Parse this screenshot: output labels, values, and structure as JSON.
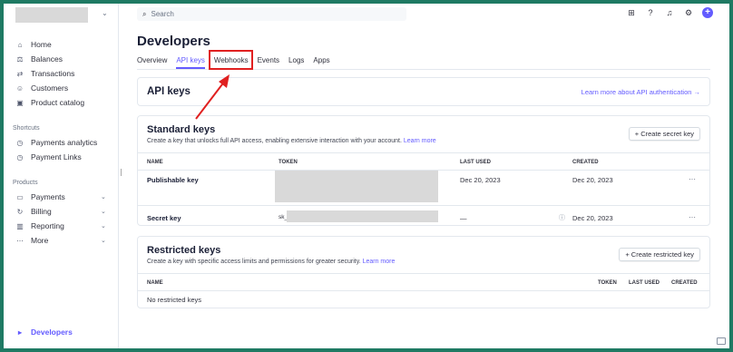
{
  "sidebar": {
    "main_items": [
      {
        "label": "Home",
        "icon": "home-icon",
        "glyph": "⌂"
      },
      {
        "label": "Balances",
        "icon": "balances-icon",
        "glyph": "⚖"
      },
      {
        "label": "Transactions",
        "icon": "transactions-icon",
        "glyph": "⇄"
      },
      {
        "label": "Customers",
        "icon": "customers-icon",
        "glyph": "☺"
      },
      {
        "label": "Product catalog",
        "icon": "product-catalog-icon",
        "glyph": "▣"
      }
    ],
    "shortcuts_title": "Shortcuts",
    "shortcuts": [
      {
        "label": "Payments analytics",
        "icon": "clock-icon",
        "glyph": "◷"
      },
      {
        "label": "Payment Links",
        "icon": "clock-icon",
        "glyph": "◷"
      }
    ],
    "products_title": "Products",
    "products": [
      {
        "label": "Payments",
        "icon": "payments-icon",
        "glyph": "▭"
      },
      {
        "label": "Billing",
        "icon": "billing-icon",
        "glyph": "↻"
      },
      {
        "label": "Reporting",
        "icon": "reporting-icon",
        "glyph": "▥"
      },
      {
        "label": "More",
        "icon": "more-icon",
        "glyph": "⋯"
      }
    ],
    "developers": {
      "label": "Developers",
      "icon": "terminal-icon",
      "glyph": "▸"
    }
  },
  "topbar": {
    "search_placeholder": "Search",
    "icons": [
      "apps-icon",
      "help-icon",
      "bell-icon",
      "settings-icon",
      "plus-icon"
    ]
  },
  "page": {
    "title": "Developers",
    "tabs": [
      "Overview",
      "API keys",
      "Webhooks",
      "Events",
      "Logs",
      "Apps"
    ],
    "active_tab": "API keys"
  },
  "api_keys_card": {
    "title": "API keys",
    "link": "Learn more about API authentication →"
  },
  "standard_keys": {
    "title": "Standard keys",
    "subtitle": "Create a key that unlocks full API access, enabling extensive interaction with your account.",
    "learn_more": "Learn more",
    "create_button": "+ Create secret key",
    "columns": [
      "NAME",
      "TOKEN",
      "LAST USED",
      "CREATED"
    ],
    "rows": [
      {
        "name": "Publishable key",
        "token": "",
        "last_used": "Dec 20, 2023",
        "created": "Dec 20, 2023"
      },
      {
        "name": "Secret key",
        "token": "sk_",
        "last_used": "—",
        "created": "Dec 20, 2023"
      }
    ],
    "row_menu": "···"
  },
  "restricted_keys": {
    "title": "Restricted keys",
    "subtitle": "Create a key with specific access limits and permissions for greater security.",
    "learn_more": "Learn more",
    "create_button": "+ Create restricted key",
    "columns": [
      "NAME",
      "TOKEN",
      "LAST USED",
      "CREATED"
    ],
    "empty": "No restricted keys"
  },
  "colors": {
    "accent": "#635bff",
    "frame": "#1f7a63",
    "annotation": "#e02020"
  }
}
